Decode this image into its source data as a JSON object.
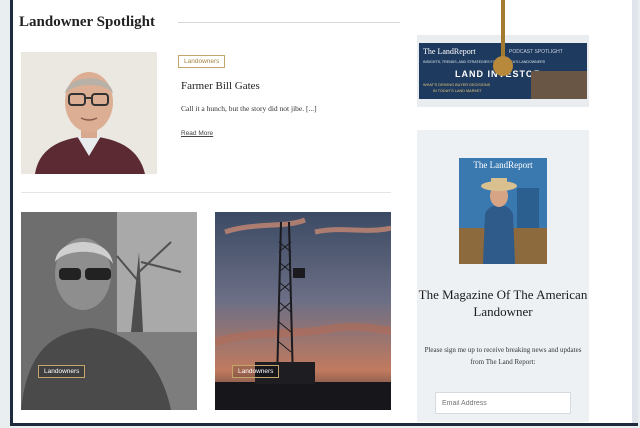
{
  "section": {
    "title": "Landowner Spotlight"
  },
  "featured": {
    "tag": "Landowners",
    "title": "Farmer Bill Gates",
    "excerpt": "Call it a hunch, but the story did not jibe. [...]",
    "read_more": "Read More"
  },
  "cards": [
    {
      "tag": "Landowners"
    },
    {
      "tag": "Landowners"
    }
  ],
  "ad": {
    "brand": "The LandReport",
    "badge": "PODCAST SPOTLIGHT",
    "tagline": "INSIGHTS, TRENDS, AND STRATEGIES FOR AMERICA'S LANDOWNERS",
    "show": "LAND INVESTOR",
    "subline1": "WHAT'S DRIVING BUYER DECISIONS",
    "subline2": "IN TODAY'S LAND MARKET"
  },
  "magazine": {
    "cover_brand": "The LandReport",
    "heading": "The Magazine Of The American Landowner",
    "signup_text": "Please sign me up to receive breaking news and updates from The Land Report:",
    "email_placeholder": "Email Address"
  },
  "colors": {
    "accent": "#b8893a",
    "frame": "#1d2b3c",
    "ad_bg": "#1e3a5f"
  }
}
